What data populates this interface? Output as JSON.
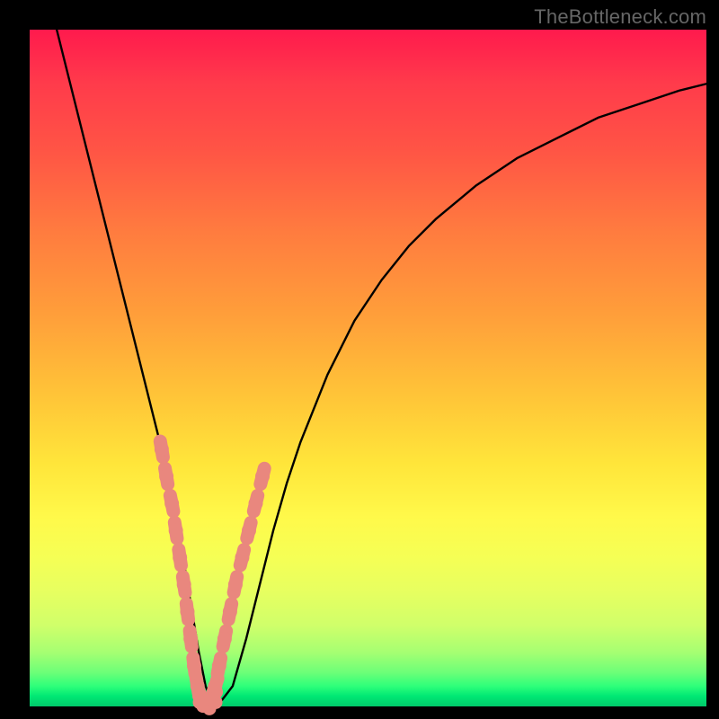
{
  "watermark": "TheBottleneck.com",
  "chart_data": {
    "type": "line",
    "title": "",
    "xlabel": "",
    "ylabel": "",
    "xlim": [
      0,
      100
    ],
    "ylim": [
      0,
      100
    ],
    "grid": false,
    "series": [
      {
        "name": "curve",
        "x": [
          4,
          6,
          8,
          10,
          12,
          14,
          16,
          18,
          20,
          22,
          23,
          24,
          25,
          26,
          27,
          28,
          30,
          32,
          34,
          36,
          38,
          40,
          44,
          48,
          52,
          56,
          60,
          66,
          72,
          78,
          84,
          90,
          96,
          100
        ],
        "y": [
          100,
          92,
          84,
          76,
          68,
          60,
          52,
          44,
          36,
          26,
          20,
          14,
          8,
          3,
          0.6,
          0.4,
          3,
          10,
          18,
          26,
          33,
          39,
          49,
          57,
          63,
          68,
          72,
          77,
          81,
          84,
          87,
          89,
          91,
          92
        ]
      }
    ],
    "highlight_points": {
      "comment": "salmon markers clustered near the minimum on both sides",
      "x": [
        19.5,
        20.2,
        21.0,
        21.6,
        22.2,
        22.8,
        23.3,
        23.8,
        24.3,
        24.8,
        25.3,
        25.8,
        26.3,
        26.8,
        27.4,
        28.0,
        28.8,
        29.6,
        30.4,
        31.4,
        32.4,
        33.4,
        34.4
      ],
      "y": [
        38,
        34,
        30,
        26,
        22,
        18,
        14,
        10,
        6,
        3,
        1.2,
        0.6,
        0.6,
        1.2,
        3,
        6,
        10,
        14,
        18,
        22,
        26,
        30,
        34
      ]
    },
    "colors": {
      "curve": "#000000",
      "marker_fill": "#e9877e",
      "marker_stroke": "#c46b63"
    }
  }
}
